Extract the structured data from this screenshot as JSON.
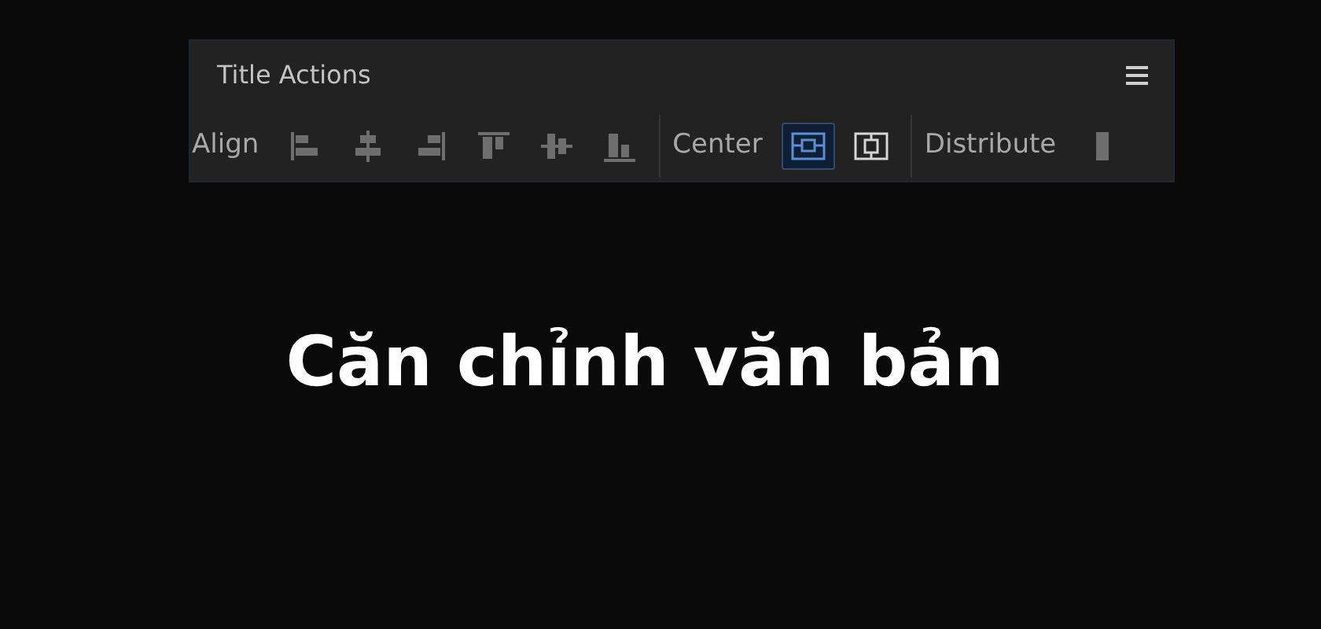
{
  "panel": {
    "title": "Title Actions",
    "groups": [
      {
        "label": "Align",
        "buttons": [
          {
            "disabled": true
          },
          {
            "disabled": true
          },
          {
            "disabled": true
          },
          {
            "disabled": true
          },
          {
            "disabled": true
          },
          {
            "disabled": true
          }
        ]
      },
      {
        "label": "Center",
        "buttons": [
          {
            "selected": true
          },
          {
            "selected": false
          }
        ]
      },
      {
        "label": "Distribute",
        "buttons": [
          {
            "disabled": true
          }
        ]
      }
    ]
  },
  "caption": "Căn chỉnh văn bản"
}
